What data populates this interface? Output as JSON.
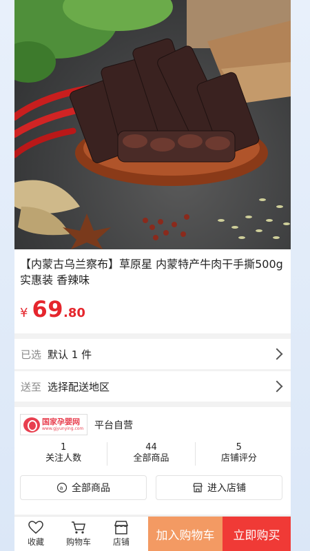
{
  "product": {
    "title": "【内蒙古乌兰察布】草原星 内蒙特产牛肉干手撕500g实惠装 香辣味",
    "price_currency": "¥",
    "price_int": "69",
    "price_dec": ".80"
  },
  "options": [
    {
      "label": "已选",
      "value": "默认  1 件"
    },
    {
      "label": "送至",
      "value": "选择配送地区"
    }
  ],
  "shop": {
    "logo_cn": "国家孕婴网",
    "logo_en": "www.gjyunying.com",
    "type": "平台自营",
    "stats": [
      {
        "value": "1",
        "label": "关注人数"
      },
      {
        "value": "44",
        "label": "全部商品"
      },
      {
        "value": "5",
        "label": "店铺评分"
      }
    ],
    "all_products_label": "全部商品",
    "enter_shop_label": "进入店铺"
  },
  "tabbar": {
    "favorite": "收藏",
    "cart": "购物车",
    "store": "店铺",
    "add_to_cart": "加入购物车",
    "buy_now": "立即购买"
  },
  "colors": {
    "price": "#e5262d",
    "add_to_cart_bg": "#f39a63",
    "buy_now_bg": "#f03a36"
  }
}
